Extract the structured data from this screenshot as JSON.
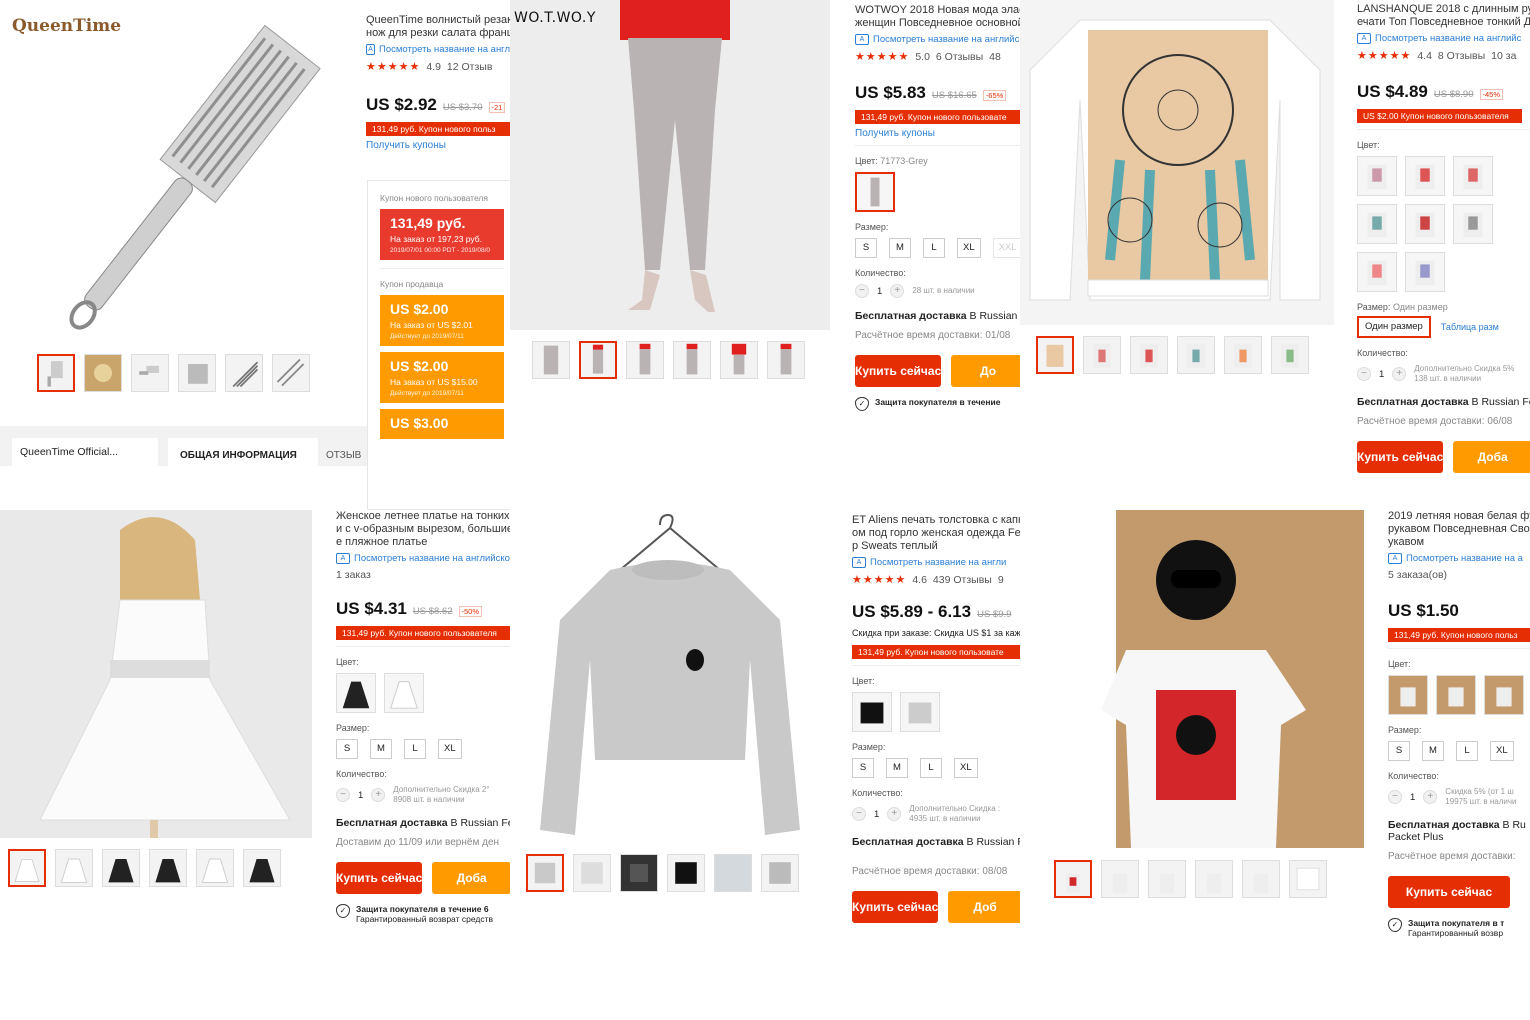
{
  "p1": {
    "brand": "QueenTime",
    "title": "QueenTime волнистый резак\nнож для резки салата франц",
    "translate": "Посмотреть название на англ",
    "rating": "4.9",
    "reviews": "12 Отзыв",
    "price": "US $2.92",
    "old_price": "US $3.70",
    "discount": "-21",
    "coupon": "131,49 руб. Купон нового польз",
    "coupon_link": "Получить купоны",
    "popup": {
      "new_label": "Купон нового пользователя",
      "new_amount": "131,49 руб.",
      "new_cond": "На заказ от 197,23 руб.",
      "new_dates": "2019/07/01 00:00 PDT - 2019/08/0",
      "seller_label": "Купон продавца",
      "c1_amount": "US $2.00",
      "c1_cond": "На заказ от  US $2.01",
      "c1_dates": "Действует до 2019/07/11",
      "c2_amount": "US $2.00",
      "c2_cond": "На заказ от  US $15.00",
      "c2_dates": "Действует до 2019/07/11",
      "c3_amount": "US $3.00"
    },
    "store": "QueenTime Official...",
    "tab_info": "ОБЩАЯ ИНФОРМАЦИЯ",
    "tab_reviews": "ОТЗЫВ"
  },
  "p2": {
    "brand": "WO.T.WO.Y"
  },
  "p3": {
    "title": "WOTWOY 2018 Новая мода эласти\nженщин Повседневное основной",
    "translate": "Посмотреть название на английс",
    "rating": "5.0",
    "reviews": "6 Отзывы",
    "orders": "48",
    "price": "US $5.83",
    "old_price": "US $16.65",
    "discount": "-65%",
    "coupon": "131,49 руб. Купон нового пользовате",
    "coupon_link": "Получить купоны",
    "color_label": "Цвет:",
    "color_value": "71773-Grey",
    "size_label": "Размер:",
    "sizes": [
      "S",
      "M",
      "L",
      "XL",
      "XXL"
    ],
    "qty_label": "Количество:",
    "qty": "1",
    "stock": "28 шт. в наличии",
    "ship": "Бесплатная доставка",
    "ship_to": "В Russian",
    "ship_time": "Расчётное время доставки: 01/08",
    "buy": "Купить сейчас",
    "add": "До",
    "protect": "Защита покупателя в течение"
  },
  "p4": {
    "title": "LANSHANQUE 2018 с длинным рука\nечати Топ Повседневное тонкий Д",
    "translate": "Посмотреть название на английс",
    "rating": "4.4",
    "reviews": "8 Отзывы",
    "orders": "10 за",
    "price": "US $4.89",
    "old_price": "US $8.90",
    "discount": "-45%",
    "coupon": "US $2.00 Купон нового пользователя",
    "color_label": "Цвет:",
    "size_label": "Размер:",
    "size_value": "Один размер",
    "size_btn": "Один размер",
    "size_table": "Таблица разм",
    "qty_label": "Количество:",
    "qty": "1",
    "stock": "Дополнительно Скидка 5%\n138 шт. в наличии",
    "ship": "Бесплатная доставка",
    "ship_to": "В Russian Fe",
    "ship_time": "Расчётное время доставки: 06/08",
    "buy": "Купить сейчас",
    "add": "Доба"
  },
  "p5": {
    "title": "Женское летнее платье на тонких б\nи с v-образным вырезом, большие\nе пляжное платье",
    "translate": "Посмотреть название на английско",
    "orders": "1 заказ",
    "price": "US $4.31",
    "old_price": "US $8.62",
    "discount": "-50%",
    "coupon": "131,49 руб. Купон нового пользователя",
    "color_label": "Цвет:",
    "size_label": "Размер:",
    "sizes": [
      "S",
      "M",
      "L",
      "XL"
    ],
    "qty_label": "Количество:",
    "qty": "1",
    "stock": "Дополнительно Скидка 2°\n8908 шт. в наличии",
    "ship": "Бесплатная доставка",
    "ship_to": "В Russian Fe",
    "ship_time": "Доставим до 11/09 или вернём ден",
    "buy": "Купить сейчас",
    "add": "Доба",
    "protect": "Защита покупателя в течение 6",
    "protect_sub": "Гарантированный возврат средств"
  },
  "p7": {
    "title": "ET Aliens печать толстовка с капю\nом под горло женская одежда Fe\nр Sweats теплый",
    "translate": "Посмотреть название на англи",
    "rating": "4.6",
    "reviews": "439 Отзывы",
    "orders": "9",
    "price": "US $5.89 - 6.13",
    "old_price": "US $9.9",
    "discount_text": "Скидка при заказе: Скидка US $1 за каж",
    "coupon": "131,49 руб. Купон нового пользовате",
    "color_label": "Цвет:",
    "size_label": "Размер:",
    "sizes": [
      "S",
      "M",
      "L",
      "XL"
    ],
    "qty_label": "Количество:",
    "qty": "1",
    "stock": "Дополнительно Скидка :\n4935 шт. в наличии",
    "ship": "Бесплатная доставка",
    "ship_to": "В Russian F",
    "ship_time": "Расчётное время доставки: 08/08",
    "buy": "Купить сейчас",
    "add": "Доб"
  },
  "p9": {
    "title": "2019 летняя новая белая фу\nрукавом Повседневная Сво\nукавом",
    "translate": "Посмотреть название на а",
    "orders": "5 заказа(ов)",
    "price": "US $1.50",
    "coupon": "131,49 руб. Купон нового польз",
    "color_label": "Цвет:",
    "size_label": "Размер:",
    "sizes": [
      "S",
      "M",
      "L",
      "XL"
    ],
    "qty_label": "Количество:",
    "qty": "1",
    "stock": "Скидка 5% (от 1 ш\n19975 шт. в наличи",
    "ship": "Бесплатная доставка",
    "ship_to": "В Ru",
    "ship_extra": "Packet Plus",
    "ship_time": "Расчётное время доставки:",
    "buy": "Купить сейчас",
    "protect": "Защита покупателя в т",
    "protect_sub": "Гарантированный возвр"
  },
  "stars": "★★★★★"
}
